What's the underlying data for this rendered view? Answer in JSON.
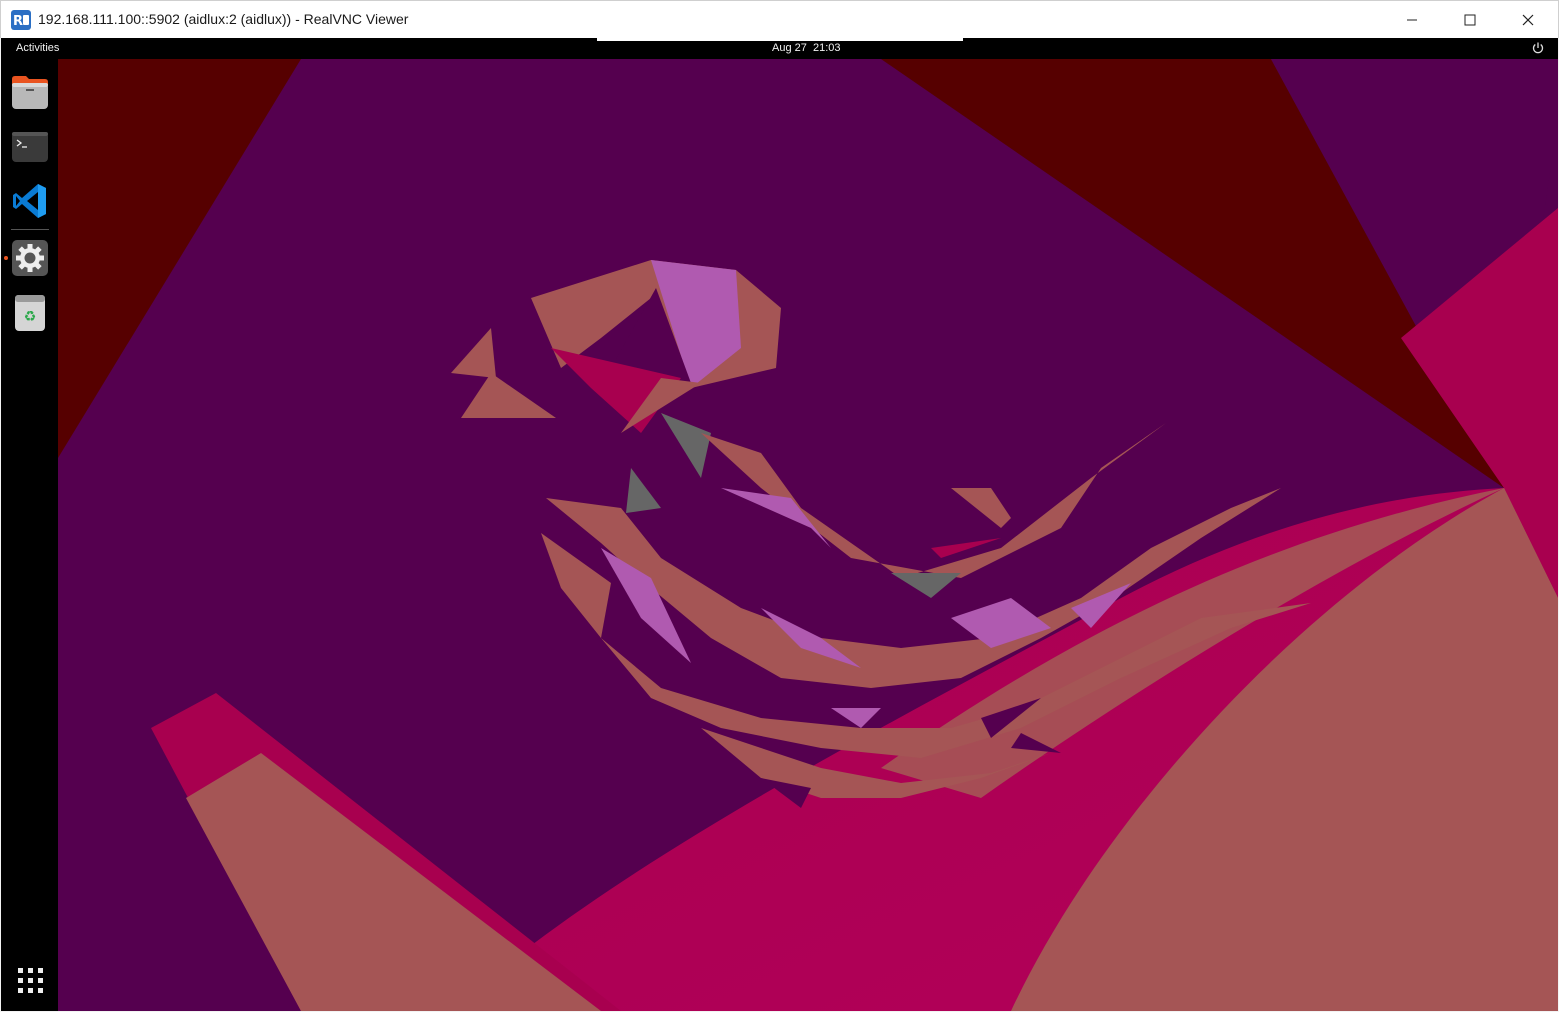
{
  "window": {
    "title": "192.168.111.100::5902 (aidlux:2 (aidlux)) - RealVNC Viewer",
    "app_icon": "realvnc-logo",
    "controls": [
      "minimize-icon",
      "maximize-icon",
      "close-icon"
    ]
  },
  "desktop": {
    "top_bar": {
      "activities_label": "Activities",
      "clock": "Aug 27  21:03",
      "power_icon": "power-icon"
    },
    "dock": {
      "items": [
        {
          "name": "Files",
          "icon": "files-icon"
        },
        {
          "name": "Terminal",
          "icon": "terminal-icon"
        },
        {
          "name": "Visual Studio Code",
          "icon": "vscode-icon"
        },
        {
          "name": "Settings",
          "icon": "settings-icon",
          "running": true
        },
        {
          "name": "Trash",
          "icon": "trash-icon"
        }
      ],
      "show_apps_icon": "app-grid-icon"
    },
    "colors": {
      "wallpaper_base": "#55004f",
      "accent": "#e95420"
    }
  }
}
